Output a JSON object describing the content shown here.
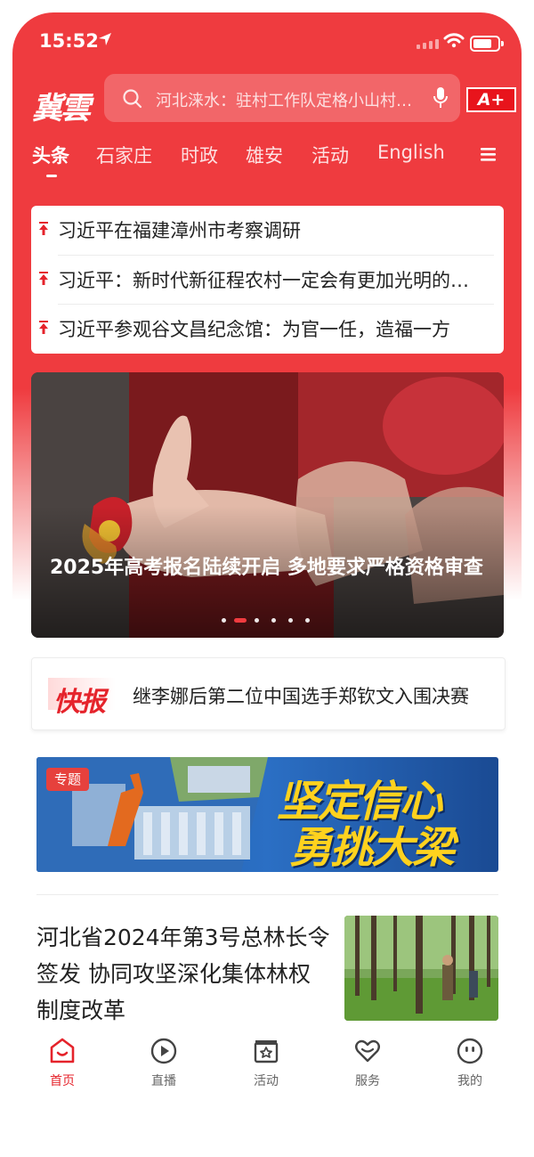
{
  "status_bar": {
    "time": "15:52"
  },
  "header": {
    "logo_text": "冀雲",
    "search_placeholder": "河北涞水：驻村工作队定格小山村…",
    "aplus_label": "A+"
  },
  "tabs": [
    {
      "label": "头条",
      "active": true
    },
    {
      "label": "石家庄"
    },
    {
      "label": "时政"
    },
    {
      "label": "雄安"
    },
    {
      "label": "活动"
    },
    {
      "label": "English"
    }
  ],
  "headlines": [
    "习近平在福建漳州市考察调研",
    "习近平：新时代新征程农村一定会有更加光明的前景",
    "习近平参观谷文昌纪念馆：为官一任，造福一方"
  ],
  "carousel": {
    "caption": "2025年高考报名陆续开启 多地要求严格资格审查",
    "slide_count": 6,
    "active_index": 1
  },
  "flash_news": {
    "badge": "快报",
    "text": "继李娜后第二位中国选手郑钦文入围决赛"
  },
  "banner": {
    "tag": "专题",
    "slogan_line1": "坚定信心",
    "slogan_line2": "勇挑大梁"
  },
  "article": {
    "title": "河北省2024年第3号总林长令签发 协同攻坚深化集体林权制度改革"
  },
  "bottom_nav": [
    {
      "label": "首页",
      "icon": "home-icon",
      "active": true
    },
    {
      "label": "直播",
      "icon": "live-play-icon"
    },
    {
      "label": "活动",
      "icon": "activity-star-icon"
    },
    {
      "label": "服务",
      "icon": "service-heart-icon"
    },
    {
      "label": "我的",
      "icon": "profile-smile-icon"
    }
  ],
  "colors": {
    "brand_red": "#ef3b3f",
    "accent_red": "#e5232b",
    "gold": "#ffd21e"
  }
}
